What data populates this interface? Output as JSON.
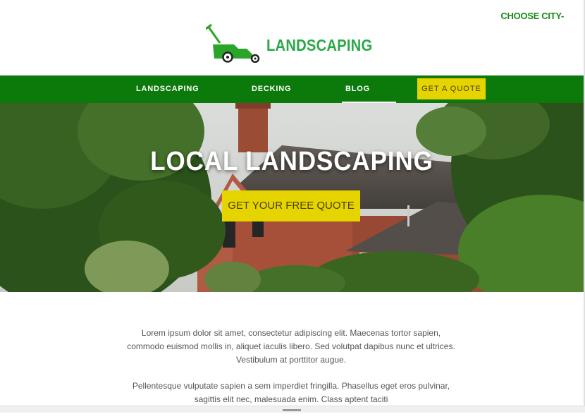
{
  "header": {
    "city_selector": "CHOOSE CITY-",
    "logo_text": "LANDSCAPING"
  },
  "nav": {
    "items": [
      {
        "label": "LANDSCAPING"
      },
      {
        "label": "DECKING"
      },
      {
        "label": "BLOG"
      }
    ],
    "quote_button": "GET A QUOTE"
  },
  "hero": {
    "title": "LOCAL LANDSCAPING",
    "cta": "GET YOUR FREE QUOTE"
  },
  "content": {
    "paragraphs": [
      "Lorem ipsum dolor sit amet, consectetur adipiscing elit. Maecenas tortor sapien, commodo euismod mollis in, aliquet iaculis libero. Sed volutpat dapibus nunc et ultrices. Vestibulum at porttitor augue.",
      "Pellentesque vulputate sapien a sem imperdiet fringilla. Phasellus eget eros pulvinar, sagittis elit nec, malesuada enim. Class aptent taciti"
    ]
  },
  "colors": {
    "brand_green": "#0b7a0b",
    "logo_green": "#2ba84a",
    "accent_yellow": "#e6d400"
  }
}
